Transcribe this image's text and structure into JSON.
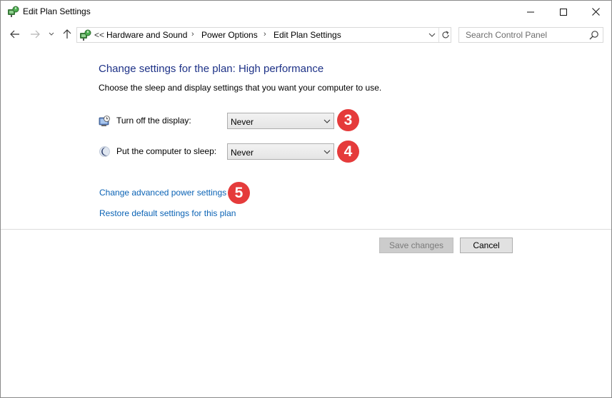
{
  "window": {
    "title": "Edit Plan Settings"
  },
  "address": {
    "overflow": "<<",
    "crumbs": [
      "Hardware and Sound",
      "Power Options",
      "Edit Plan Settings"
    ]
  },
  "search": {
    "placeholder": "Search Control Panel"
  },
  "content": {
    "heading": "Change settings for the plan: High performance",
    "subheading": "Choose the sleep and display settings that you want your computer to use.",
    "settings": [
      {
        "label": "Turn off the display:",
        "value": "Never",
        "icon": "monitor-clock-icon"
      },
      {
        "label": "Put the computer to sleep:",
        "value": "Never",
        "icon": "moon-icon"
      }
    ],
    "links": {
      "advanced": "Change advanced power settings",
      "restore": "Restore default settings for this plan"
    }
  },
  "badges": [
    "3",
    "4",
    "5"
  ],
  "buttons": {
    "save": "Save changes",
    "cancel": "Cancel"
  },
  "colors": {
    "heading": "#1e3287",
    "link": "#0b63b5",
    "badge": "#e53b3b"
  }
}
